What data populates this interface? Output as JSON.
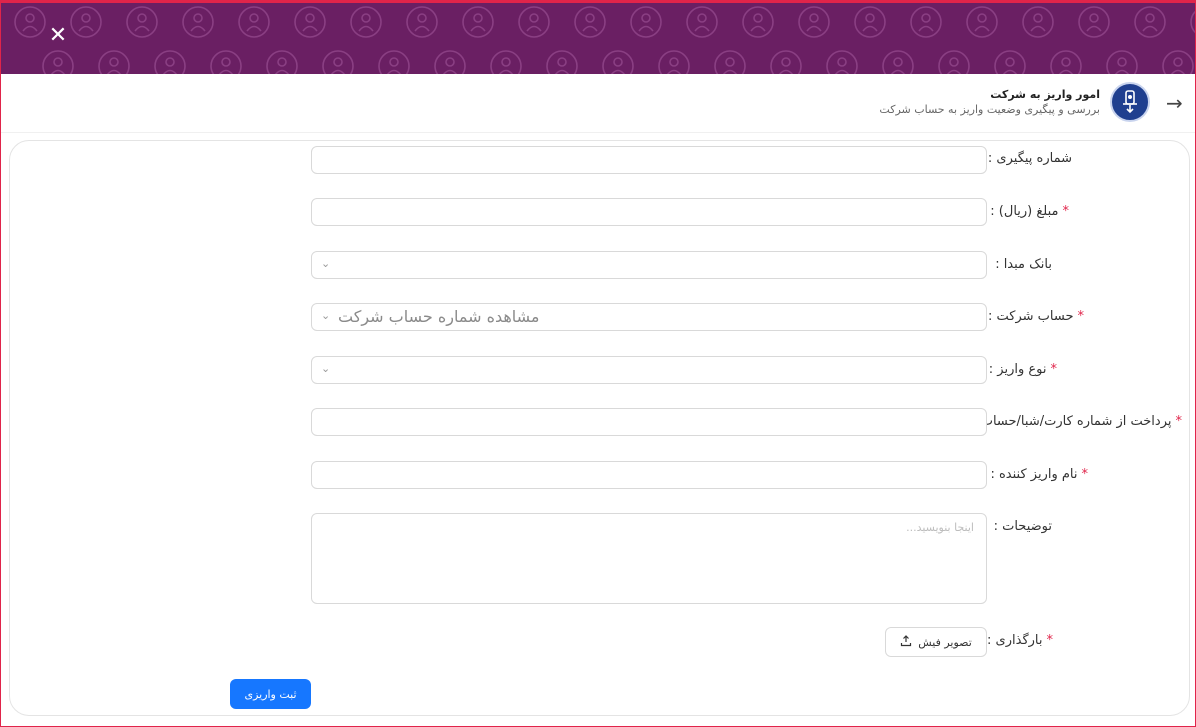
{
  "header": {
    "close_icon": "✕",
    "title": "امور واریز به شرکت",
    "subtitle": "بررسی و پیگیری وضعیت واریز به حساب شرکت",
    "back_icon": "→",
    "avatar_icon": "deposit-logo-icon"
  },
  "colors": {
    "banner": "#6a1f63",
    "accent": "#1677ff",
    "required": "#e0244a"
  },
  "form": {
    "tracking_number_label": "شماره پیگیری :",
    "amount_label": "مبلغ (ریال) :",
    "source_bank_label": "بانک مبدا :",
    "company_account_label": "حساب شرکت :",
    "company_account_value": "مشاهده شماره حساب شرکت",
    "deposit_type_label": "نوع واریز :",
    "payment_from_label": "پرداخت از شماره کارت/شبا/حساب",
    "depositor_name_label": "نام واریز کننده :",
    "description_label": "توضیحات :",
    "description_placeholder": "اینجا بنویسید...",
    "upload_label": "بارگذاری :",
    "upload_button": "تصویر فیش",
    "required_mark": "*",
    "submit_button": "ثبت واریزی"
  }
}
